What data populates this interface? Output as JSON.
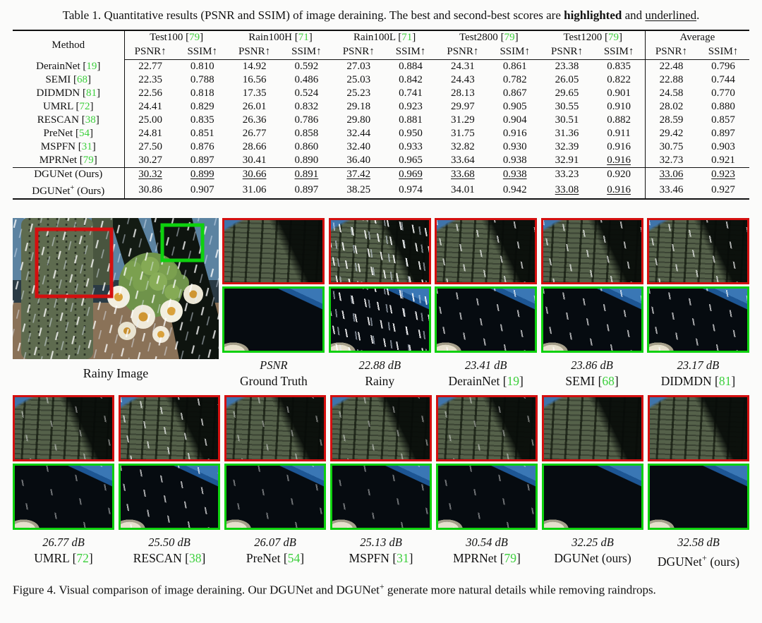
{
  "colors": {
    "cite_green": "#3bcf3b",
    "red_box": "#d40f0f",
    "green_box": "#0ed10e"
  },
  "table": {
    "caption": {
      "prefix": "Table 1. Quantitative results (PSNR and SSIM) of image deraining. The best and second-best scores are ",
      "bold": "highlighted",
      "mid": " and ",
      "underline": "underlined",
      "suffix": "."
    },
    "method_header": "Method",
    "psnr_header": "PSNR↑",
    "ssim_header": "SSIM↑",
    "groups": [
      {
        "name": "Test100",
        "cite": "79"
      },
      {
        "name": "Rain100H",
        "cite": "71"
      },
      {
        "name": "Rain100L",
        "cite": "71"
      },
      {
        "name": "Test2800",
        "cite": "79"
      },
      {
        "name": "Test1200",
        "cite": "79"
      },
      {
        "name": "Average",
        "cite": null
      }
    ],
    "rows": [
      {
        "method": {
          "base": "DerainNet",
          "cite": "19"
        },
        "values": [
          "22.77",
          "0.810",
          "14.92",
          "0.592",
          "27.03",
          "0.884",
          "24.31",
          "0.861",
          "23.38",
          "0.835",
          "22.48",
          "0.796"
        ]
      },
      {
        "method": {
          "base": "SEMI",
          "cite": "68"
        },
        "values": [
          "22.35",
          "0.788",
          "16.56",
          "0.486",
          "25.03",
          "0.842",
          "24.43",
          "0.782",
          "26.05",
          "0.822",
          "22.88",
          "0.744"
        ]
      },
      {
        "method": {
          "base": "DIDMDN",
          "cite": "81"
        },
        "values": [
          "22.56",
          "0.818",
          "17.35",
          "0.524",
          "25.23",
          "0.741",
          "28.13",
          "0.867",
          "29.65",
          "0.901",
          "24.58",
          "0.770"
        ]
      },
      {
        "method": {
          "base": "UMRL",
          "cite": "72"
        },
        "values": [
          "24.41",
          "0.829",
          "26.01",
          "0.832",
          "29.18",
          "0.923",
          "29.97",
          "0.905",
          "30.55",
          "0.910",
          "28.02",
          "0.880"
        ]
      },
      {
        "method": {
          "base": "RESCAN",
          "cite": "38"
        },
        "values": [
          "25.00",
          "0.835",
          "26.36",
          "0.786",
          "29.80",
          "0.881",
          "31.29",
          "0.904",
          "30.51",
          "0.882",
          "28.59",
          "0.857"
        ]
      },
      {
        "method": {
          "base": "PreNet",
          "cite": "54"
        },
        "values": [
          "24.81",
          "0.851",
          "26.77",
          "0.858",
          "32.44",
          "0.950",
          "31.75",
          "0.916",
          "31.36",
          "0.911",
          "29.42",
          "0.897"
        ]
      },
      {
        "method": {
          "base": "MSPFN",
          "cite": "31"
        },
        "values": [
          "27.50",
          "0.876",
          "28.66",
          "0.860",
          "32.40",
          "0.933",
          "32.82",
          "0.930",
          "32.39",
          "0.916",
          "30.75",
          "0.903"
        ]
      },
      {
        "method": {
          "base": "MPRNet",
          "cite": "79"
        },
        "values": [
          "30.27",
          "0.897",
          "30.41",
          "0.890",
          "36.40",
          "0.965",
          "33.64",
          "0.938",
          "32.91",
          {
            "v": "0.916",
            "mark": "second"
          },
          "32.73",
          "0.921"
        ]
      },
      {
        "method": {
          "base": "DGUNet",
          "tail": " (Ours)"
        },
        "rule_above": true,
        "values": [
          {
            "v": "30.32",
            "mark": "second"
          },
          {
            "v": "0.899",
            "mark": "second"
          },
          {
            "v": "30.66",
            "mark": "second"
          },
          {
            "v": "0.891",
            "mark": "second"
          },
          {
            "v": "37.42",
            "mark": "second"
          },
          {
            "v": "0.969",
            "mark": "second"
          },
          {
            "v": "33.68",
            "mark": "second"
          },
          {
            "v": "0.938",
            "mark": "second"
          },
          {
            "v": "33.23",
            "mark": "best"
          },
          {
            "v": "0.920",
            "mark": "best"
          },
          {
            "v": "33.06",
            "mark": "second"
          },
          {
            "v": "0.923",
            "mark": "second"
          }
        ]
      },
      {
        "method": {
          "base": "DGUNet",
          "sup": "+",
          "tail": " (Ours)"
        },
        "values": [
          {
            "v": "30.86",
            "mark": "best"
          },
          {
            "v": "0.907",
            "mark": "best"
          },
          {
            "v": "31.06",
            "mark": "best"
          },
          {
            "v": "0.897",
            "mark": "best"
          },
          {
            "v": "38.25",
            "mark": "best"
          },
          {
            "v": "0.974",
            "mark": "best"
          },
          {
            "v": "34.01",
            "mark": "best"
          },
          {
            "v": "0.942",
            "mark": "best"
          },
          {
            "v": "33.08",
            "mark": "second"
          },
          {
            "v": "0.916",
            "mark": "second"
          },
          {
            "v": "33.46",
            "mark": "best"
          },
          {
            "v": "0.927",
            "mark": "best"
          }
        ]
      }
    ]
  },
  "figure": {
    "reference_label": "Rainy Image",
    "row1_panels": [
      {
        "value": "PSNR",
        "label": {
          "base": "Ground Truth"
        },
        "rain": 0
      },
      {
        "value": "22.88 dB",
        "label": {
          "base": "Rainy"
        },
        "rain": 3
      },
      {
        "value": "23.41 dB",
        "label": {
          "base": "DerainNet",
          "cite": "19"
        },
        "rain": 2
      },
      {
        "value": "23.86 dB",
        "label": {
          "base": "SEMI",
          "cite": "68"
        },
        "rain": 2
      },
      {
        "value": "23.17 dB",
        "label": {
          "base": "DIDMDN",
          "cite": "81"
        },
        "rain": 2
      }
    ],
    "row2_panels": [
      {
        "value": "26.77 dB",
        "label": {
          "base": "UMRL",
          "cite": "72"
        },
        "rain": 1
      },
      {
        "value": "25.50 dB",
        "label": {
          "base": "RESCAN",
          "cite": "38"
        },
        "rain": 2
      },
      {
        "value": "26.07 dB",
        "label": {
          "base": "PreNet",
          "cite": "54"
        },
        "rain": 1
      },
      {
        "value": "25.13 dB",
        "label": {
          "base": "MSPFN",
          "cite": "31"
        },
        "rain": 1
      },
      {
        "value": "30.54 dB",
        "label": {
          "base": "MPRNet",
          "cite": "79"
        },
        "rain": 1
      },
      {
        "value": "32.25 dB",
        "label": {
          "base": "DGUNet",
          "tail": " (ours)"
        },
        "rain": 0
      },
      {
        "value": "32.58 dB",
        "label": {
          "base": "DGUNet",
          "sup": "+",
          "tail": " (ours)"
        },
        "rain": 0
      }
    ],
    "caption": {
      "prefix": "Figure 4. Visual comparison of image deraining. Our DGUNet and DGUNet",
      "sup": "+",
      "suffix": " generate more natural details while removing raindrops."
    }
  }
}
